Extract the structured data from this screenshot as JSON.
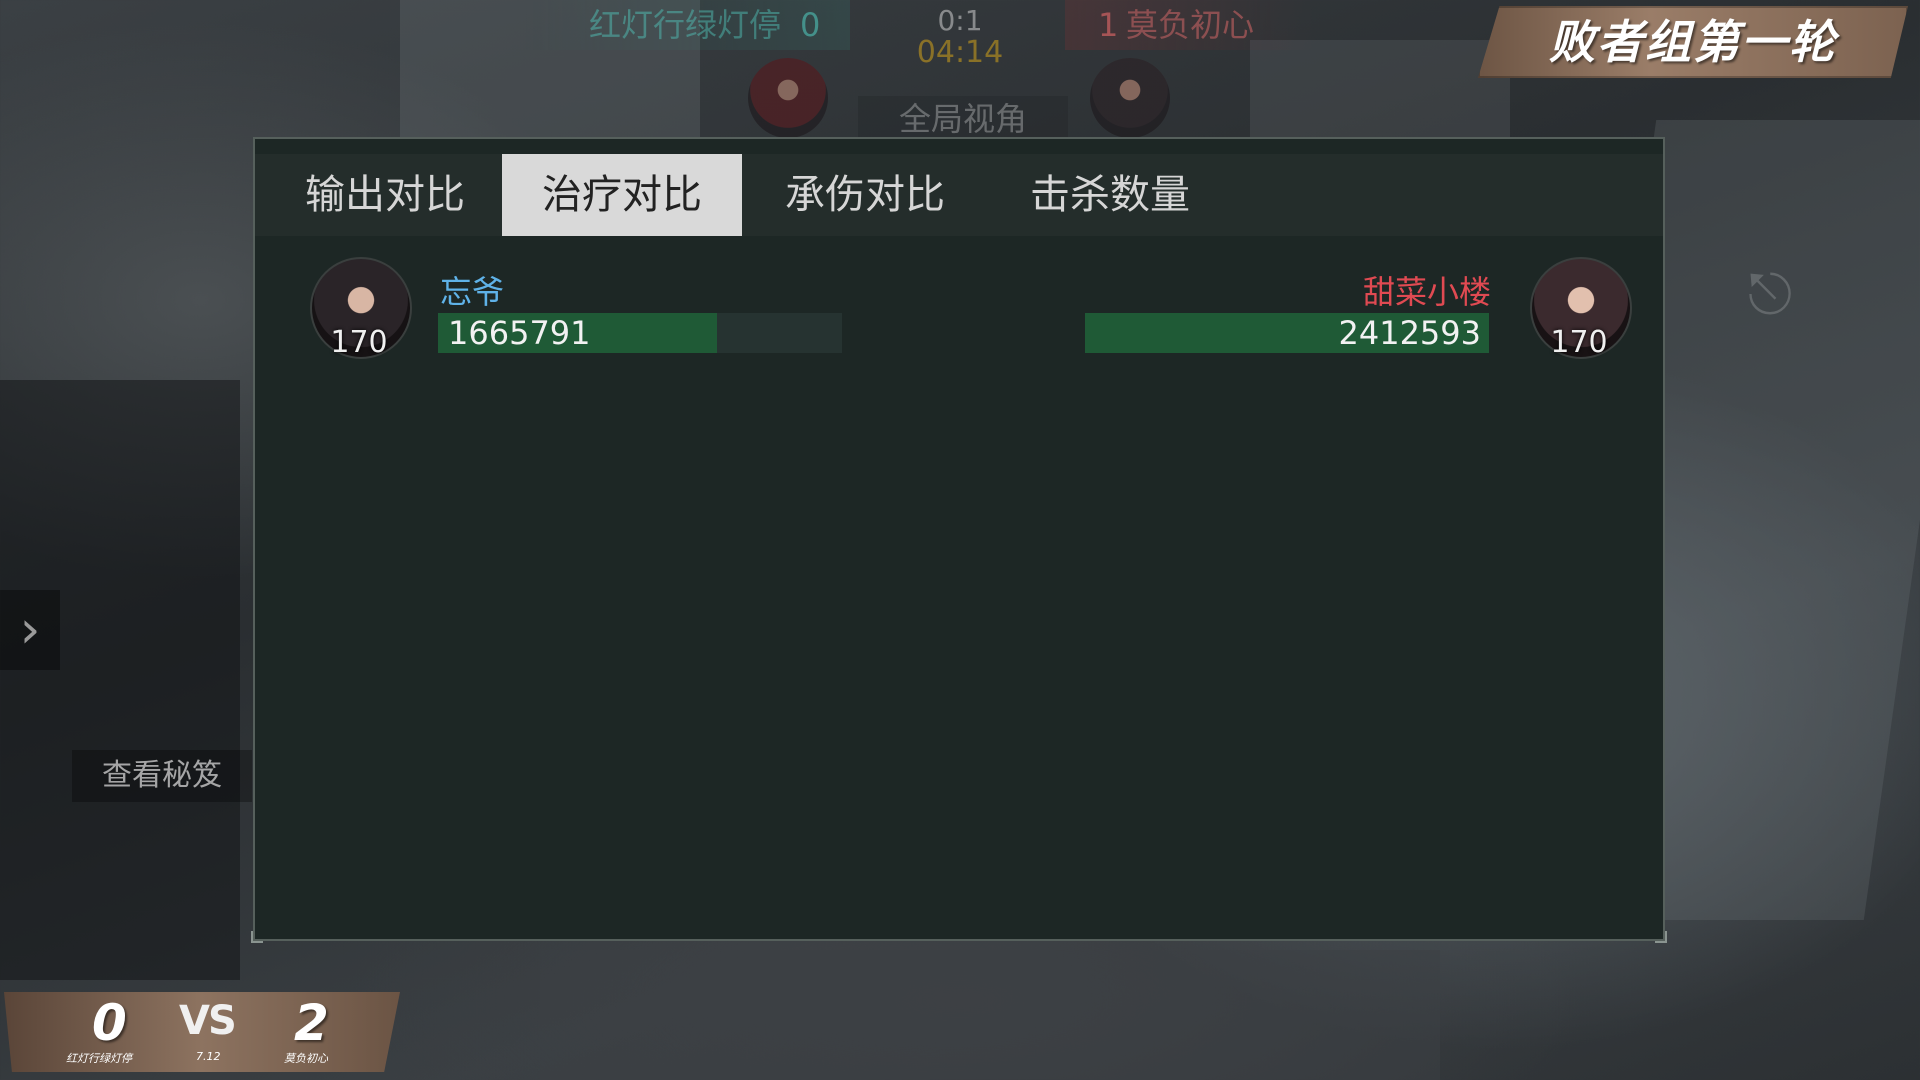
{
  "top_hud": {
    "left_team": "红灯行绿灯停",
    "left_score": "0",
    "right_team": "莫负初心",
    "right_score": "1",
    "round_score": "0:1",
    "timer": "04:14",
    "view_label": "全局视角"
  },
  "round_banner": "败者组第一轮",
  "replay_label": "重播中",
  "tabs": [
    {
      "label": "输出对比",
      "selected": false
    },
    {
      "label": "治疗对比",
      "selected": true
    },
    {
      "label": "承伤对比",
      "selected": false
    },
    {
      "label": "击杀数量",
      "selected": false
    }
  ],
  "comparison": {
    "left": {
      "name": "忘爷",
      "level": "170",
      "value": "1665791",
      "fill_fraction": 0.69
    },
    "right": {
      "name": "甜菜小楼",
      "level": "170",
      "value": "2412593",
      "fill_fraction": 1.0
    }
  },
  "side": {
    "cheat_button": "查看秘笈"
  },
  "bottom_board": {
    "left_score": "0",
    "vs": "VS",
    "right_score": "2",
    "left_team": "红灯行绿灯停",
    "right_team": "莫负初心",
    "date": "7.12"
  },
  "colors": {
    "left_player": "#5fb2e8",
    "right_player": "#e04a52",
    "bar_fill": "#1f5a36",
    "timer": "#d2a21a"
  }
}
